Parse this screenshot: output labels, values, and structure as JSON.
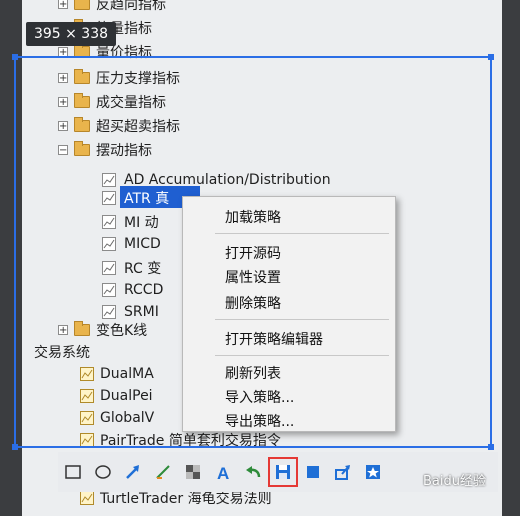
{
  "dimension_badge": "395 × 338",
  "tree": {
    "folders_top": [
      {
        "label": "反趋向指标"
      },
      {
        "label": "能量指标"
      },
      {
        "label": "量价指标"
      },
      {
        "label": "压力支撑指标"
      },
      {
        "label": "成交量指标"
      },
      {
        "label": "超买超卖指标"
      },
      {
        "label": "摆动指标"
      }
    ],
    "indicators": [
      {
        "label": "AD Accumulation/Distribution"
      },
      {
        "label": "ATR 真"
      },
      {
        "label": "MI 动"
      },
      {
        "label": "MICD"
      },
      {
        "label": "RC 变"
      },
      {
        "label": "RCCD"
      },
      {
        "label": "SRMI"
      }
    ],
    "folder_bottom": {
      "label": "变色K线"
    },
    "section_title": "交易系统",
    "strategies": [
      {
        "label": "DualMA"
      },
      {
        "label": "DualPei"
      },
      {
        "label": "GlobalV"
      },
      {
        "label": "PairTrade 简单套利交易指令"
      },
      {
        "label": "TurtleTrader 海龟交易法则"
      }
    ]
  },
  "context_menu": {
    "items": [
      "加载策略",
      "打开源码",
      "属性设置",
      "删除策略",
      "打开策略编辑器",
      "刷新列表",
      "导入策略...",
      "导出策略..."
    ]
  },
  "watermark": "Baidu经验",
  "accent_color": "#1f5fd1",
  "annotation_color": "#e53935"
}
